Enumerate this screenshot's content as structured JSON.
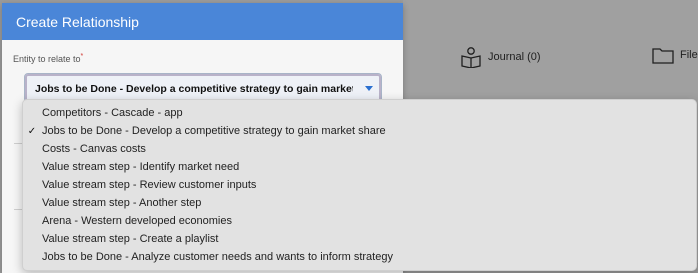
{
  "background": {
    "journal_label": "Journal (0)",
    "files_label": "File"
  },
  "dialog": {
    "title": "Create Relationship",
    "field_label": "Entity to relate to",
    "required_marker": "*",
    "selected_value": "Jobs to be Done - Develop a competitive strategy to gain market s"
  },
  "dropdown": {
    "options": [
      {
        "label": "Competitors - Cascade - app",
        "selected": false
      },
      {
        "label": "Jobs to be Done - Develop a competitive strategy to gain market share",
        "selected": true,
        "check": "✓"
      },
      {
        "label": "Costs - Canvas costs",
        "selected": false
      },
      {
        "label": "Value stream step - Identify market need",
        "selected": false
      },
      {
        "label": "Value stream step - Review customer inputs",
        "selected": false
      },
      {
        "label": "Value stream step - Another step",
        "selected": false
      },
      {
        "label": "Arena - Western developed economies",
        "selected": false
      },
      {
        "label": "Value stream step - Create a playlist",
        "selected": false
      },
      {
        "label": "Jobs to be Done - Analyze customer needs and wants to inform strategy",
        "selected": false
      }
    ]
  }
}
